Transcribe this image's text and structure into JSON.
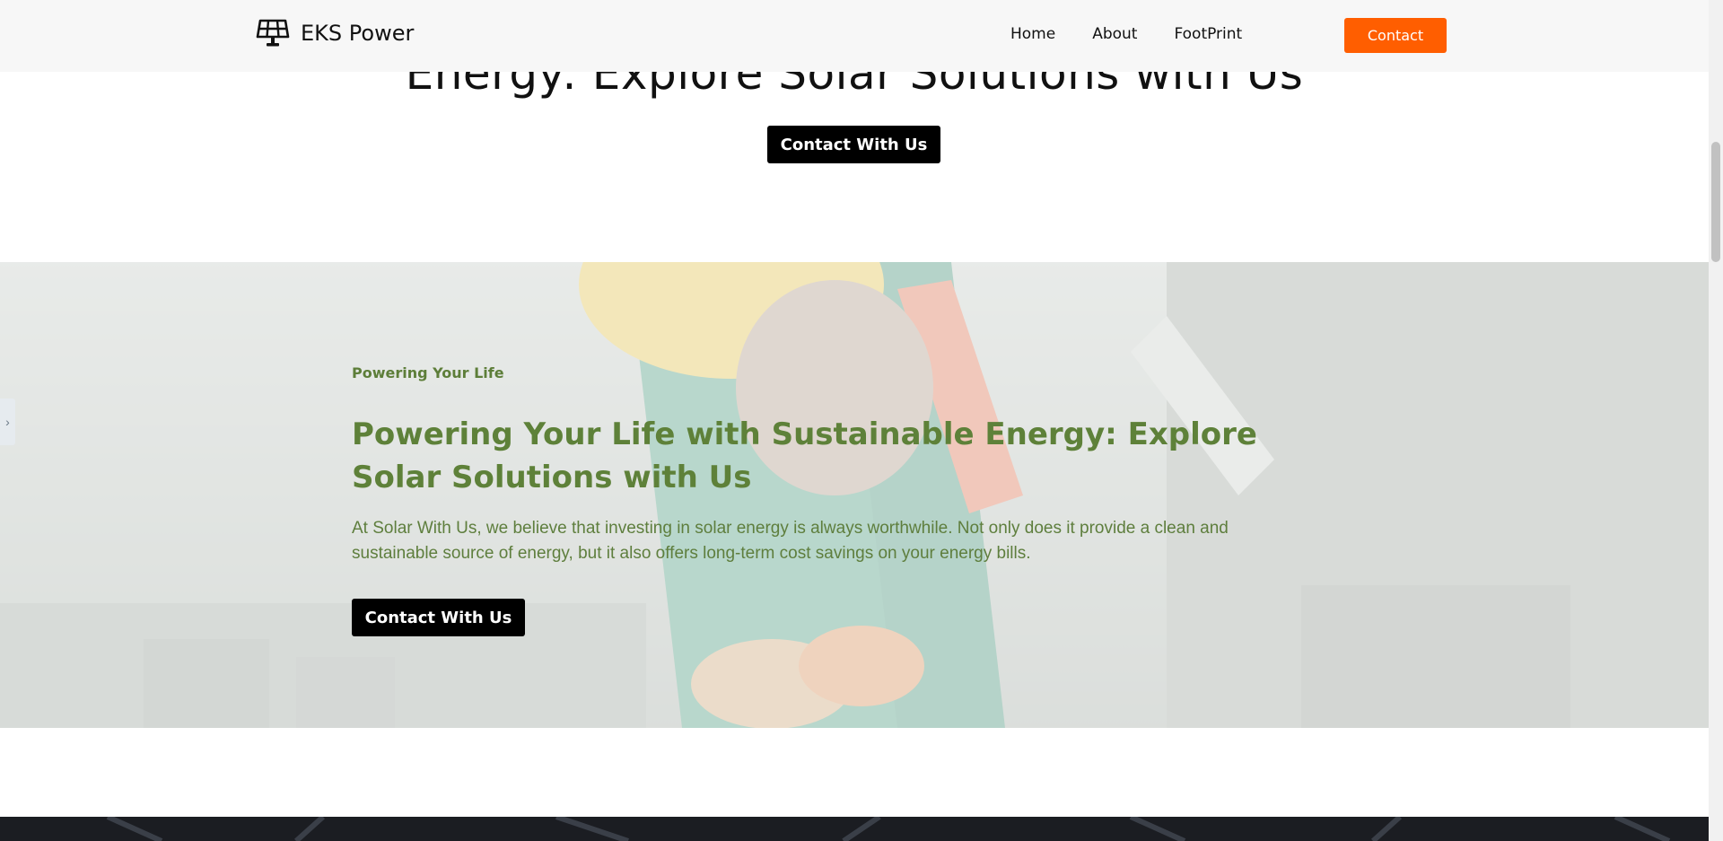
{
  "header": {
    "brand": "EKS Power",
    "nav": [
      {
        "label": "Home"
      },
      {
        "label": "About"
      },
      {
        "label": "FootPrint"
      }
    ],
    "contact_label": "Contact"
  },
  "hero_top": {
    "title": "Energy: Explore Solar Solutions with Us",
    "button_label": "Contact With Us"
  },
  "feature": {
    "eyebrow": "Powering Your Life",
    "heading": "Powering Your Life with Sustainable Energy: Explore Solar Solutions with Us",
    "body": "At Solar With Us, we believe that investing in solar energy is always worthwhile. Not only does it provide a clean and sustainable source of energy, but it also offers long-term cost savings on your energy bills.",
    "button_label": "Contact With Us"
  },
  "side_tab": {
    "glyph": "›"
  },
  "colors": {
    "accent_orange": "#ff5e00",
    "heading_green": "#5e8139",
    "button_black": "#000000",
    "header_bg": "#f7f7f7"
  },
  "icons": {
    "logo": "solar-panel-icon",
    "side_tab": "chevron-right-icon"
  }
}
